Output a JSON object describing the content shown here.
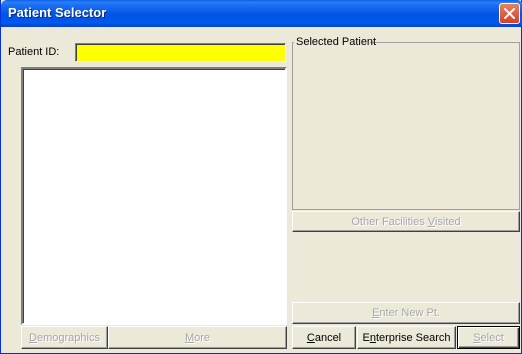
{
  "window": {
    "title": "Patient Selector"
  },
  "patient_id": {
    "label": "Patient ID:",
    "value": ""
  },
  "selected_patient": {
    "legend": "Selected Patient"
  },
  "buttons": {
    "other_facilities": {
      "pre": "Other Facilities ",
      "key": "V",
      "post": "isited"
    },
    "enter_new_pt": {
      "pre": "",
      "key": "E",
      "post": "nter New Pt."
    },
    "demographics": {
      "pre": "",
      "key": "D",
      "post": "emographics"
    },
    "more": {
      "pre": "",
      "key": "M",
      "post": "ore"
    },
    "cancel": {
      "pre": "",
      "key": "C",
      "post": "ancel"
    },
    "enterprise_search": {
      "pre": "E",
      "key": "n",
      "post": "terprise Search"
    },
    "select": {
      "pre": "",
      "key": "S",
      "post": "elect"
    }
  },
  "colors": {
    "title_bar": "#0054e3",
    "input_background": "#ffff00",
    "dialog_face": "#ece9d8"
  },
  "icons": {
    "close": "close-icon"
  }
}
